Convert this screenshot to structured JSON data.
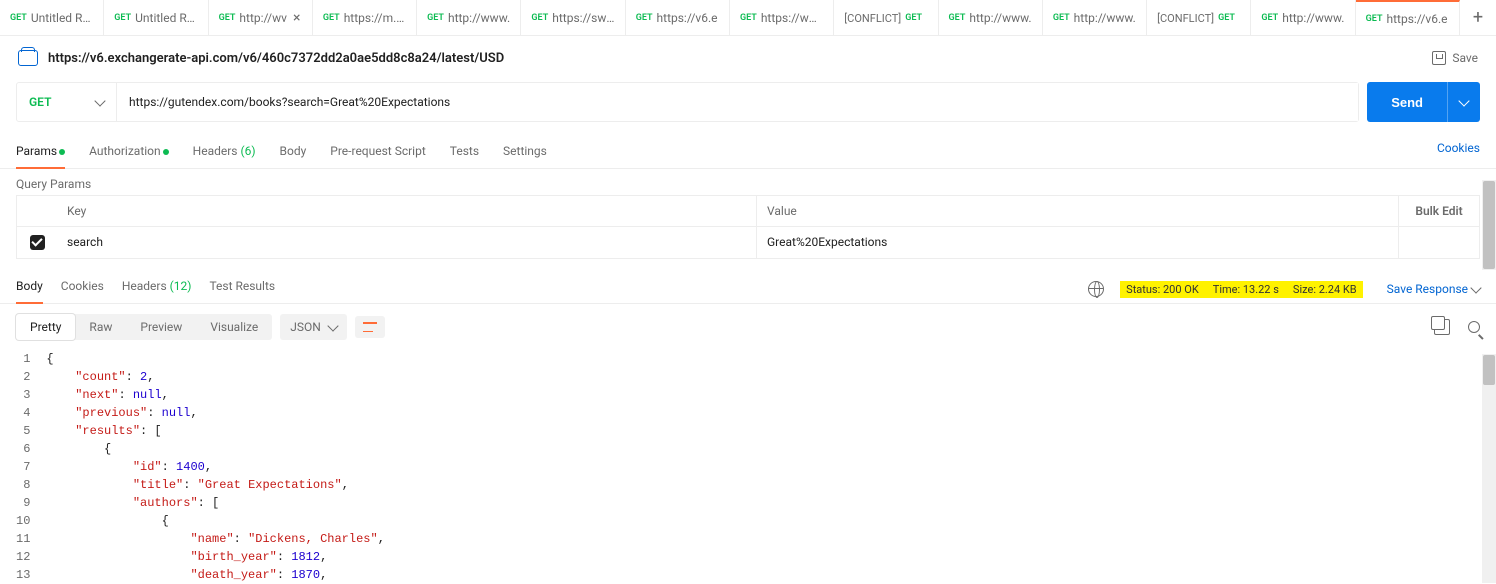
{
  "tabs": [
    {
      "method": "GET",
      "title": "Untitled Req",
      "close": false
    },
    {
      "method": "GET",
      "title": "Untitled Req",
      "close": false
    },
    {
      "method": "GET",
      "title": "http://wv",
      "close": true
    },
    {
      "method": "GET",
      "title": "https://m.me",
      "close": false
    },
    {
      "method": "GET",
      "title": "http://www.",
      "close": false
    },
    {
      "method": "GET",
      "title": "https://swap",
      "close": false
    },
    {
      "method": "GET",
      "title": "https://v6.e",
      "close": false
    },
    {
      "method": "GET",
      "title": "https://www",
      "close": false
    },
    {
      "conflict": "[CONFLICT]",
      "method": "GET",
      "title": "",
      "close": false
    },
    {
      "method": "GET",
      "title": "http://www.",
      "close": false
    },
    {
      "method": "GET",
      "title": "http://www.",
      "close": false
    },
    {
      "conflict": "[CONFLICT]",
      "method": "GET",
      "title": "",
      "close": false
    },
    {
      "method": "GET",
      "title": "http://www.",
      "close": false
    },
    {
      "method": "GET",
      "title": "https://v6.e",
      "close": false,
      "active": true
    }
  ],
  "header": {
    "breadcrumb": "https://v6.exchangerate-api.com/v6/460c7372dd2a0ae5dd8c8a24/latest/USD",
    "save": "Save"
  },
  "request": {
    "method": "GET",
    "url": "https://gutendex.com/books?search=Great%20Expectations",
    "send": "Send"
  },
  "reqtabs": {
    "params": "Params",
    "auth": "Authorization",
    "headers": "Headers",
    "headers_count": "(6)",
    "body": "Body",
    "prereq": "Pre-request Script",
    "tests": "Tests",
    "settings": "Settings",
    "cookies": "Cookies"
  },
  "qp": {
    "title": "Query Params",
    "key_h": "Key",
    "val_h": "Value",
    "bulk": "Bulk Edit",
    "rows": [
      {
        "checked": true,
        "key": "search",
        "value": "Great%20Expectations"
      }
    ]
  },
  "resp": {
    "tabs": {
      "body": "Body",
      "cookies": "Cookies",
      "headers": "Headers",
      "headers_count": "(12)",
      "tests": "Test Results"
    },
    "status": {
      "status": "Status: 200 OK",
      "time": "Time: 13.22 s",
      "size": "Size: 2.24 KB"
    },
    "save": "Save Response"
  },
  "view": {
    "pretty": "Pretty",
    "raw": "Raw",
    "preview": "Preview",
    "visualize": "Visualize",
    "fmt": "JSON"
  },
  "code": {
    "lines": [
      "1",
      "2",
      "3",
      "4",
      "5",
      "6",
      "7",
      "8",
      "9",
      "10",
      "11",
      "12",
      "13"
    ],
    "count": 2,
    "id": 1400,
    "birth_year": 1812,
    "death_year": 1870,
    "str": {
      "count": "\"count\"",
      "next": "\"next\"",
      "previous": "\"previous\"",
      "results": "\"results\"",
      "id": "\"id\"",
      "title": "\"title\"",
      "gtexp": "\"Great Expectations\"",
      "authors": "\"authors\"",
      "name": "\"name\"",
      "dickens": "\"Dickens, Charles\"",
      "birth": "\"birth_year\"",
      "death": "\"death_year\""
    },
    "kw": {
      "null": "null"
    }
  }
}
